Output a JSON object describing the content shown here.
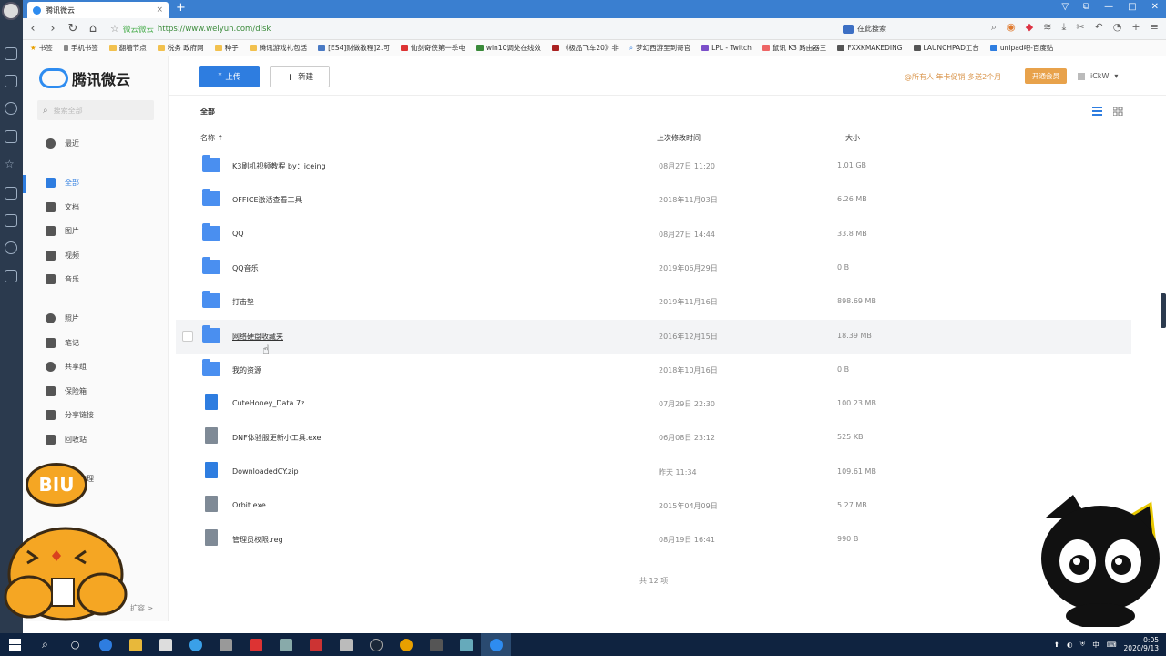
{
  "browser": {
    "tab_title": "腾讯微云",
    "tab_close": "×",
    "new_tab": "+",
    "site_label": "微云微云",
    "url": "https://www.weiyun.com/disk",
    "search_placeholder": "在此搜索",
    "bookmarks": [
      "书签",
      "手机书签",
      "翻墙节点",
      "税务 政府网",
      "种子",
      "腾讯游戏礼包活",
      "[ES4]财做教程]2.可",
      "仙剑奇侠第一季电",
      "win10调处在线效",
      "《极品飞车20》非",
      "梦幻西游至到哥官",
      "LPL - Twitch",
      "鼠讯 K3 路由器三",
      "FXXKMAKEDING",
      "LAUNCHPAD工台",
      "unipad吧-百度贴"
    ]
  },
  "sidebar": {
    "logo_text": "腾讯微云",
    "search_placeholder": "搜索全部",
    "items": [
      {
        "label": "最近"
      },
      {
        "label": "全部"
      },
      {
        "label": "文档"
      },
      {
        "label": "图片"
      },
      {
        "label": "视频"
      },
      {
        "label": "音乐"
      },
      {
        "label": "照片"
      },
      {
        "label": "笔记"
      },
      {
        "label": "共享组"
      },
      {
        "label": "保险箱"
      },
      {
        "label": "分享链接"
      },
      {
        "label": "回收站"
      },
      {
        "label": "访问管理"
      }
    ],
    "expand_label": "扩容 >"
  },
  "toolbar": {
    "upload_label": "上传",
    "new_label": "新建",
    "promo_text": "@所有人 年卡促销 多送2个月",
    "vip_label": "开通会员",
    "user_name": "iCkW"
  },
  "main": {
    "breadcrumb": "全部",
    "columns": {
      "name": "名称 ↑",
      "modified": "上次修改时间",
      "size": "大小"
    },
    "files": [
      {
        "name": "K3刷机视频教程 by：iceing",
        "date": "08月27日 11:20",
        "size": "1.01 GB",
        "type": "folder"
      },
      {
        "name": "OFFICE激活查看工具",
        "date": "2018年11月03日",
        "size": "6.26 MB",
        "type": "folder"
      },
      {
        "name": "QQ",
        "date": "08月27日 14:44",
        "size": "33.8 MB",
        "type": "folder"
      },
      {
        "name": "QQ音乐",
        "date": "2019年06月29日",
        "size": "0 B",
        "type": "folder"
      },
      {
        "name": "打击垫",
        "date": "2019年11月16日",
        "size": "898.69 MB",
        "type": "folder"
      },
      {
        "name": "网络硬盘收藏夹",
        "date": "2016年12月15日",
        "size": "18.39 MB",
        "type": "folder"
      },
      {
        "name": "我的资源",
        "date": "2018年10月16日",
        "size": "0 B",
        "type": "folder"
      },
      {
        "name": "CuteHoney_Data.7z",
        "date": "07月29日 22:30",
        "size": "100.23 MB",
        "type": "zip"
      },
      {
        "name": "DNF体验服更新小工具.exe",
        "date": "06月08日 23:12",
        "size": "525 KB",
        "type": "file"
      },
      {
        "name": "DownloadedCY.zip",
        "date": "昨天 11:34",
        "size": "109.61 MB",
        "type": "zip"
      },
      {
        "name": "Orbit.exe",
        "date": "2015年04月09日",
        "size": "5.27 MB",
        "type": "file"
      },
      {
        "name": "管理员权限.reg",
        "date": "08月19日 16:41",
        "size": "990 B",
        "type": "file"
      }
    ],
    "total": "共 12 项"
  },
  "stickers": {
    "biu_text": "BIU"
  },
  "taskbar": {
    "time": "0:05",
    "date": "2020/9/13",
    "ime": "中"
  },
  "colors": {
    "accent": "#2e7de0",
    "tabbar": "#3a7fd0",
    "folder": "#4a8ff0",
    "promo": "#d9944a",
    "vip": "#e8a24b"
  }
}
